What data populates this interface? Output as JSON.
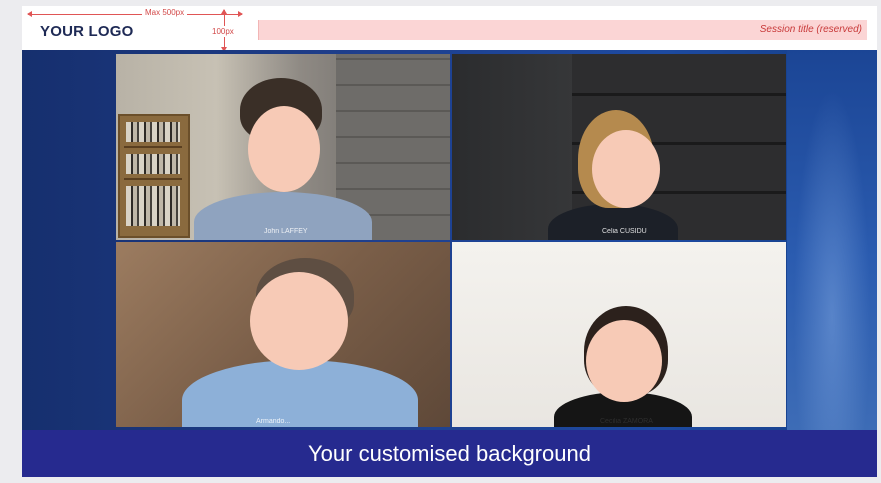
{
  "header": {
    "logo_text": "YOUR LOGO",
    "max_width_label": "Max 500px",
    "height_label": "100px",
    "session_title": "Session title (reserved)"
  },
  "video_tiles": [
    {
      "name_tag": "John LAFFEY"
    },
    {
      "name_tag": "Celia CUSIDU"
    },
    {
      "name_tag": "Armando..."
    },
    {
      "name_tag": "Cecilia ZAMORA"
    }
  ],
  "banner": {
    "text": "Your customised background"
  },
  "colors": {
    "logo": "#1e2a55",
    "annotation_red": "#d24848",
    "session_bar": "#fbd5d5",
    "background_blue": "#1f3f8d",
    "banner": "#262a8f"
  }
}
